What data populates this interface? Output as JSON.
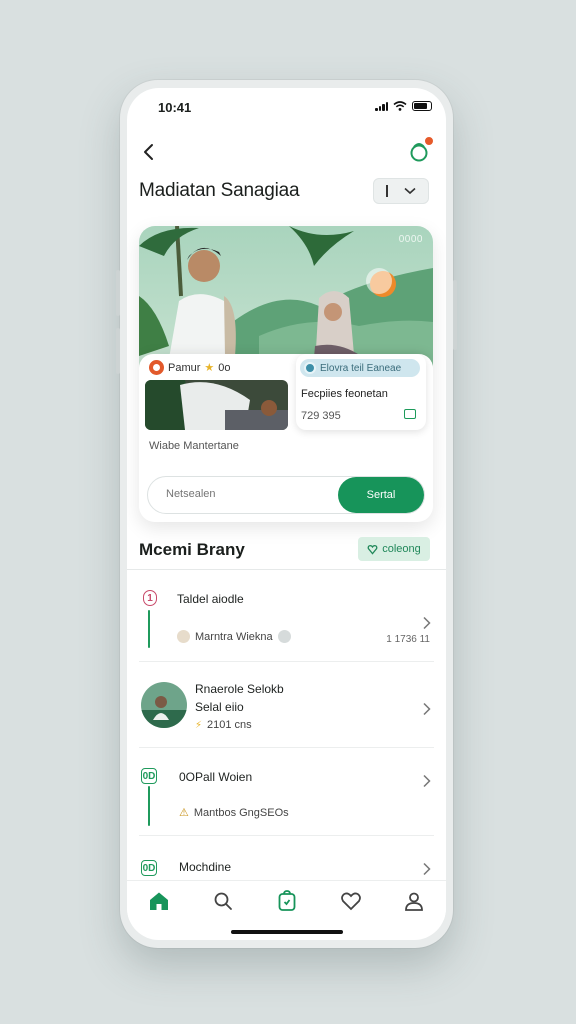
{
  "status_bar": {
    "time": "10:41"
  },
  "header": {
    "title": "Madiatan Sanagiaa",
    "selector_value": "|"
  },
  "hero": {
    "tag": "0000",
    "inner": {
      "pill_label": "Pamur",
      "pill_suffix": "0o",
      "promo_chip": "Elovra teil Eaneae",
      "promo_title": "Fecpiies feonetan",
      "promo_number": "729 395",
      "caption": "Wiabe Mantertane"
    },
    "search": {
      "placeholder": "Netsealen",
      "button_label": "Sertal"
    }
  },
  "section": {
    "title": "Mcemi Brany",
    "badge_label": "coleong"
  },
  "rows": [
    {
      "badge": "1",
      "title": "Taldel aiodle",
      "sub": "Marntra Wiekna",
      "meta": "1 1736 11"
    },
    {
      "title": "Rnaerole Selokb",
      "title2": "Selal eiio",
      "sub": "2101 cns"
    },
    {
      "badge": "0D",
      "title": "0OPall Woien",
      "sub": "Mantbos GngSEOs"
    },
    {
      "badge": "0D",
      "title": "Mochdine"
    }
  ],
  "tabs": [
    "home",
    "search",
    "bag",
    "favorites",
    "profile"
  ],
  "colors": {
    "accent": "#17945a",
    "badge_bg": "#d9efe3",
    "notify": "#e65a2a"
  }
}
